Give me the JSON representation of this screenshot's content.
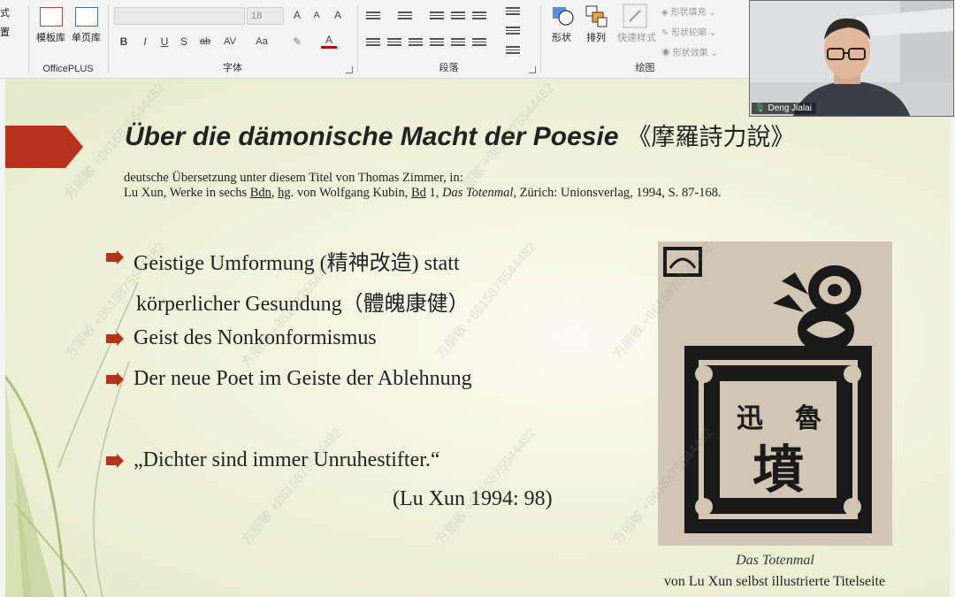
{
  "ribbon": {
    "left_partial": [
      "式",
      "置"
    ],
    "officeplus": {
      "btn1": "模板库",
      "btn2": "单页库",
      "label": "OfficePLUS"
    },
    "font": {
      "name_value": "",
      "size_value": "18",
      "label": "字体",
      "bold": "B",
      "italic": "I",
      "underline": "U",
      "shadow": "S",
      "strike": "ab",
      "spacing": "AV",
      "case": "Aa",
      "grow": "A",
      "shrink": "A"
    },
    "paragraph": {
      "label": "段落"
    },
    "drawing": {
      "shape_label": "形状",
      "arrange_label": "排列",
      "quickstyle_label": "快速样式",
      "fill": "形状填充",
      "outline": "形状轮廓",
      "effects": "形状效果",
      "label": "绘图"
    }
  },
  "slide": {
    "title": "Über die dämonische Macht der Poesie",
    "title_cn": "《摩羅詩力說》",
    "ref_line1": "deutsche Übersetzung unter diesem Titel von Thomas Zimmer, in:",
    "ref_line2": {
      "prefix": "Lu Xun, Werke in sechs ",
      "bdn": "Bdn",
      "mid1": ", ",
      "hg": "hg",
      "mid2": ". von Wolfgang Kubin, ",
      "bd": "Bd",
      "mid3": " 1, ",
      "book": "Das Totenmal",
      "suffix": ", Zürich: Unionsverlag, 1994, S. 87-168."
    },
    "bullets": [
      "Geistige Umformung (精神改造) statt",
      "körperlicher Gesundung（體魄康健）",
      "Geist des Nonkonformismus",
      "Der neue Poet im Geiste der Ablehnung",
      "„Dichter sind immer Unruhestifter.“"
    ],
    "quote_source": "(Lu Xun 1994: 98)",
    "cover_chars": [
      "魯",
      "迅",
      "墳"
    ],
    "caption_title": "Das Totenmal",
    "caption_sub": "von Lu Xun selbst illustrierte Titelseite",
    "watermark": "方丽敏 +8615875544482",
    "colors": {
      "accent": "#b5331a"
    }
  },
  "video": {
    "name": "Deng Jialai"
  }
}
